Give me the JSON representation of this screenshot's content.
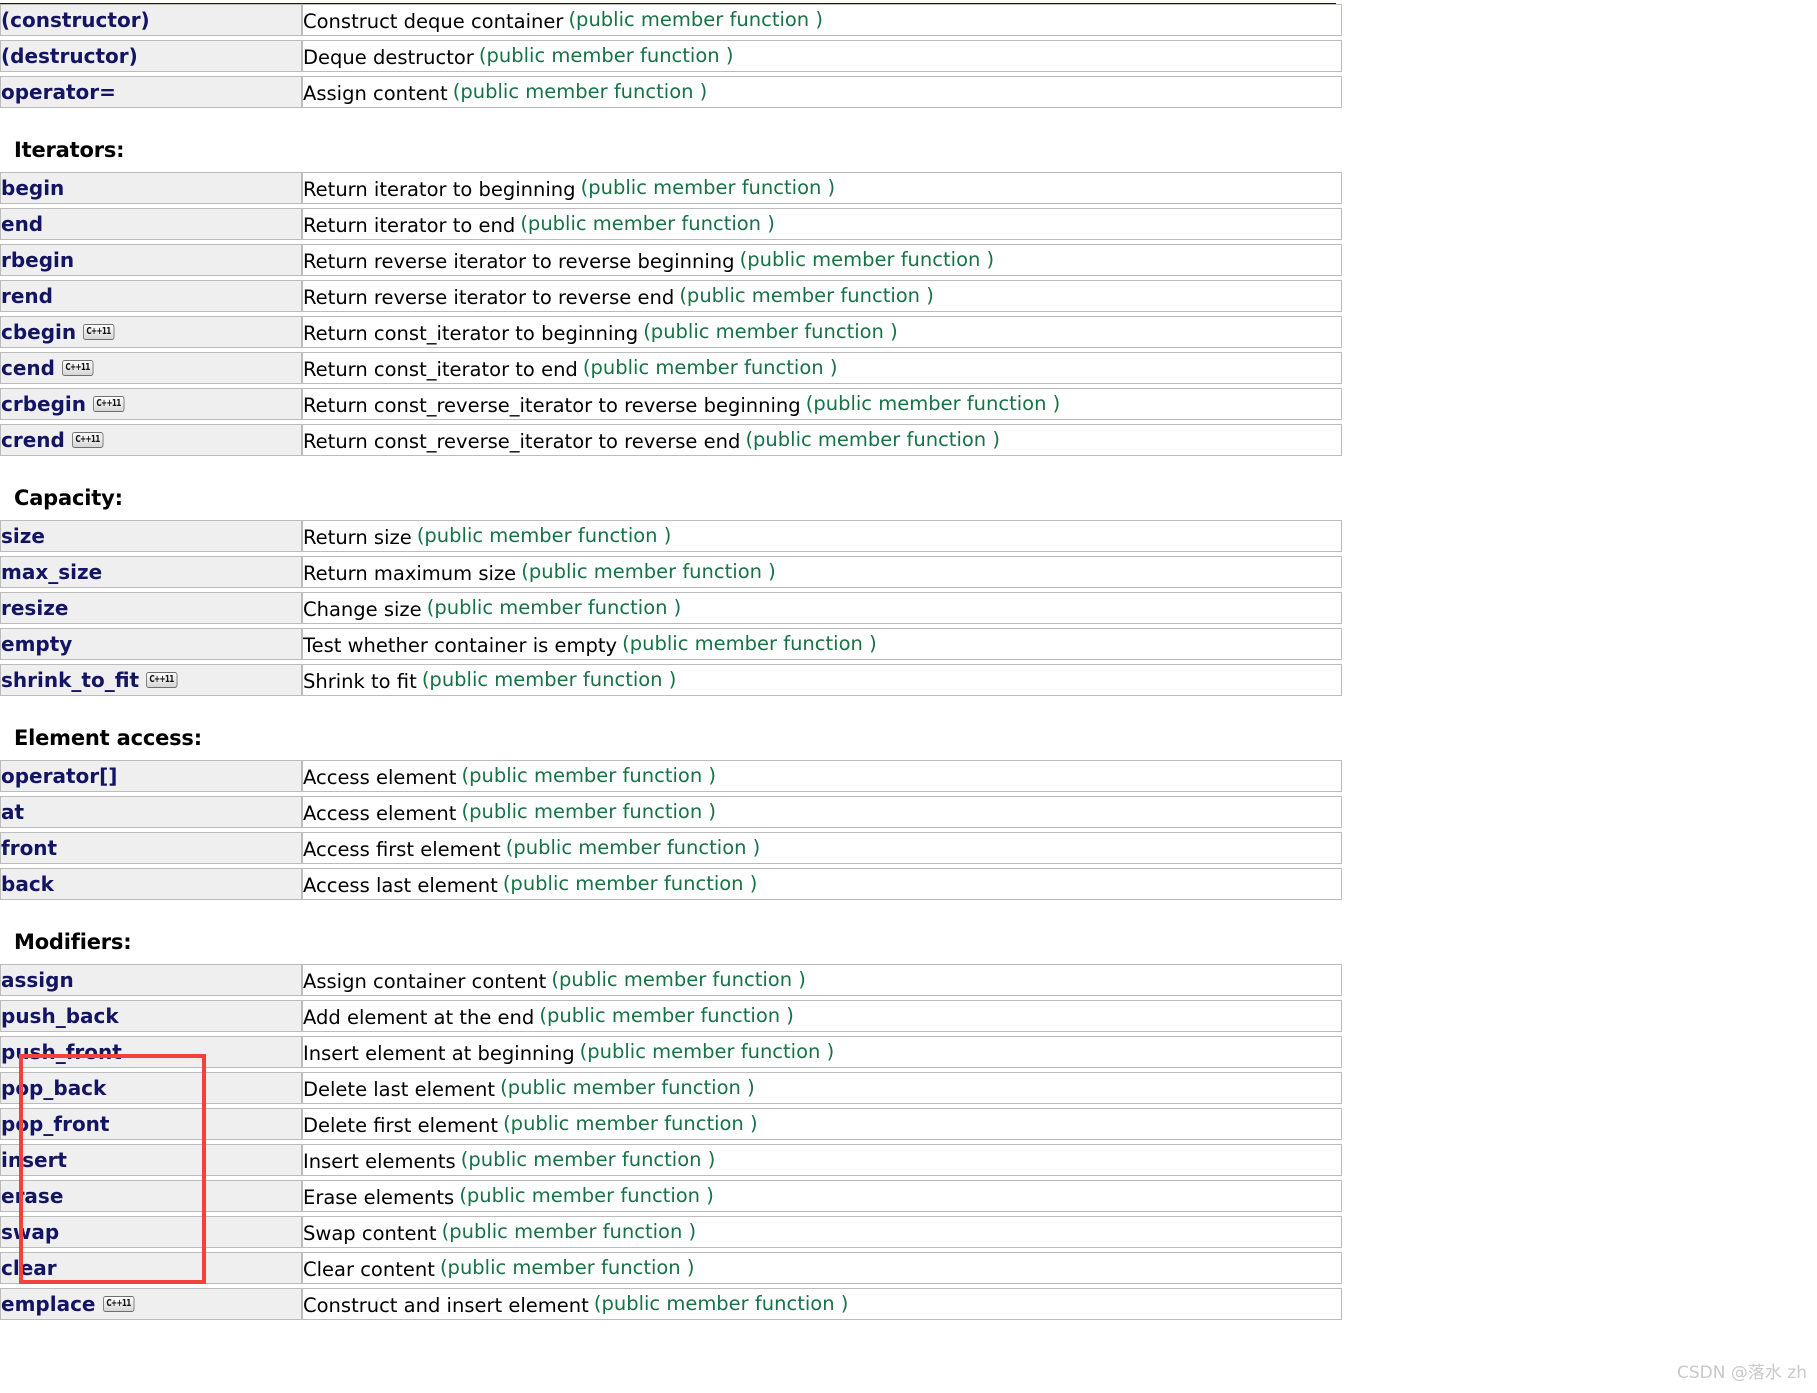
{
  "page": {
    "watermark": "CSDN @落水 zh",
    "accent_rule_color": "#141464",
    "name_color": "#141464",
    "note_color": "#177245",
    "name_cell_bg": "#efefef",
    "cell_border": "#bcbcbc",
    "highlight_color": "#f4413c",
    "badge_label": "C++11"
  },
  "sections": [
    {
      "title": "",
      "rows": [
        {
          "name": "(constructor)",
          "badge": "",
          "desc": "Construct deque container",
          "note": "(public member function )"
        },
        {
          "name": "(destructor)",
          "badge": "",
          "desc": "Deque destructor",
          "note": "(public member function )"
        },
        {
          "name": "operator=",
          "badge": "",
          "desc": "Assign content",
          "note": "(public member function )"
        }
      ]
    },
    {
      "title": "Iterators",
      "rows": [
        {
          "name": "begin",
          "badge": "",
          "desc": "Return iterator to beginning",
          "note": "(public member function )"
        },
        {
          "name": "end",
          "badge": "",
          "desc": "Return iterator to end",
          "note": "(public member function )"
        },
        {
          "name": "rbegin",
          "badge": "",
          "desc": "Return reverse iterator to reverse beginning",
          "note": "(public member function )"
        },
        {
          "name": "rend",
          "badge": "",
          "desc": "Return reverse iterator to reverse end",
          "note": "(public member function )"
        },
        {
          "name": "cbegin",
          "badge": "C++11",
          "desc": "Return const_iterator to beginning",
          "note": "(public member function )"
        },
        {
          "name": "cend",
          "badge": "C++11",
          "desc": "Return const_iterator to end",
          "note": "(public member function )"
        },
        {
          "name": "crbegin",
          "badge": "C++11",
          "desc": "Return const_reverse_iterator to reverse beginning",
          "note": "(public member function )"
        },
        {
          "name": "crend",
          "badge": "C++11",
          "desc": "Return const_reverse_iterator to reverse end",
          "note": "(public member function )"
        }
      ]
    },
    {
      "title": "Capacity",
      "rows": [
        {
          "name": "size",
          "badge": "",
          "desc": "Return size",
          "note": "(public member function )"
        },
        {
          "name": "max_size",
          "badge": "",
          "desc": "Return maximum size",
          "note": "(public member function )"
        },
        {
          "name": "resize",
          "badge": "",
          "desc": "Change size",
          "note": "(public member function )"
        },
        {
          "name": "empty",
          "badge": "",
          "desc": "Test whether container is empty",
          "note": "(public member function )"
        },
        {
          "name": "shrink_to_fit",
          "badge": "C++11",
          "desc": "Shrink to fit",
          "note": "(public member function )"
        }
      ]
    },
    {
      "title": "Element access",
      "rows": [
        {
          "name": "operator[]",
          "badge": "",
          "desc": "Access element",
          "note": "(public member function )"
        },
        {
          "name": "at",
          "badge": "",
          "desc": "Access element",
          "note": "(public member function )"
        },
        {
          "name": "front",
          "badge": "",
          "desc": "Access first element",
          "note": "(public member function )"
        },
        {
          "name": "back",
          "badge": "",
          "desc": "Access last element",
          "note": "(public member function )"
        }
      ]
    },
    {
      "title": "Modifiers",
      "rows": [
        {
          "name": "assign",
          "badge": "",
          "desc": "Assign container content",
          "note": "(public member function )"
        },
        {
          "name": "push_back",
          "badge": "",
          "desc": "Add element at the end",
          "note": "(public member function )"
        },
        {
          "name": "push_front",
          "badge": "",
          "desc": "Insert element at beginning",
          "note": "(public member function )"
        },
        {
          "name": "pop_back",
          "badge": "",
          "desc": "Delete last element",
          "note": "(public member function )"
        },
        {
          "name": "pop_front",
          "badge": "",
          "desc": "Delete first element",
          "note": "(public member function )"
        },
        {
          "name": "insert",
          "badge": "",
          "desc": "Insert elements",
          "note": "(public member function )"
        },
        {
          "name": "erase",
          "badge": "",
          "desc": "Erase elements",
          "note": "(public member function )"
        },
        {
          "name": "swap",
          "badge": "",
          "desc": "Swap content",
          "note": "(public member function )"
        },
        {
          "name": "clear",
          "badge": "",
          "desc": "Clear content",
          "note": "(public member function )"
        },
        {
          "name": "emplace",
          "badge": "C++11",
          "desc": "Construct and insert element",
          "note": "(public member function )"
        }
      ]
    }
  ]
}
